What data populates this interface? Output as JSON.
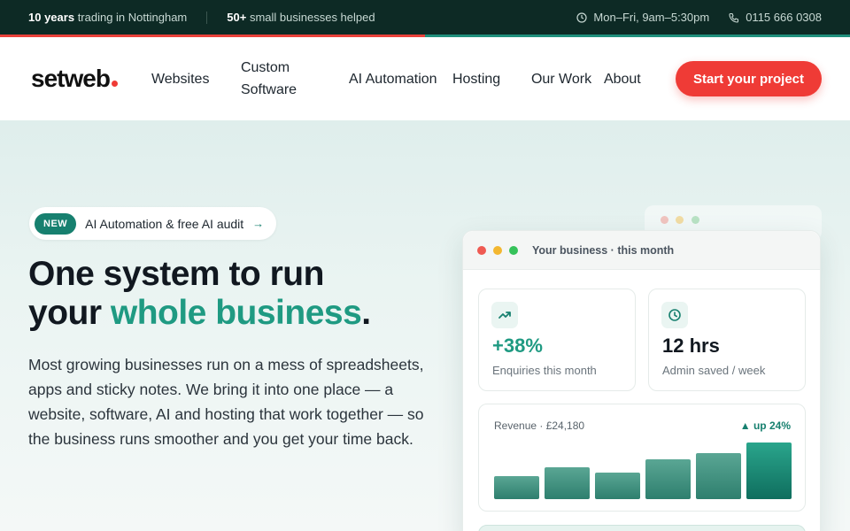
{
  "topbar": {
    "years_bold": "10 years",
    "years_text": "trading in Nottingham",
    "helped_bold": "50+",
    "helped_text": "small businesses helped",
    "hours": "Mon–Fri, 9am–5:30pm",
    "phone": "0115 666 0308"
  },
  "header": {
    "logo": "setweb",
    "nav": {
      "websites": "Websites",
      "custom_software": "Custom Software",
      "ai_automation": "AI Automation",
      "hosting": "Hosting",
      "our_work": "Our Work",
      "about": "About"
    },
    "cta": "Start your project"
  },
  "hero": {
    "badge": "NEW",
    "pill_text": "AI Automation & free AI audit",
    "pill_arrow": "→",
    "headline_line1": "One system to run",
    "headline_line2_start": "your ",
    "headline_highlight": "whole business",
    "headline_end": ".",
    "paragraph": "Most growing businesses run on a mess of spreadsheets, apps and sticky notes. We bring it into one place — a website, software, AI and hosting that work together — so the business runs smoother and you get your time back."
  },
  "dashboard": {
    "title": "Your business · this month",
    "stat1": {
      "value": "+38%",
      "label": "Enquiries this month",
      "icon": "trend-up-icon"
    },
    "stat2": {
      "value": "12 hrs",
      "label": "Admin saved / week",
      "icon": "clock-icon"
    },
    "revenue": {
      "label": "Revenue · £24,180",
      "change": "▲ up 24%"
    }
  },
  "chart_data": {
    "type": "bar",
    "values": [
      26,
      36,
      30,
      45,
      52,
      64
    ],
    "ylim": [
      0,
      64
    ]
  },
  "colors": {
    "accent_red": "#ef3b36",
    "accent_green": "#1f9a82",
    "topbar_bg": "#0d2a25"
  }
}
